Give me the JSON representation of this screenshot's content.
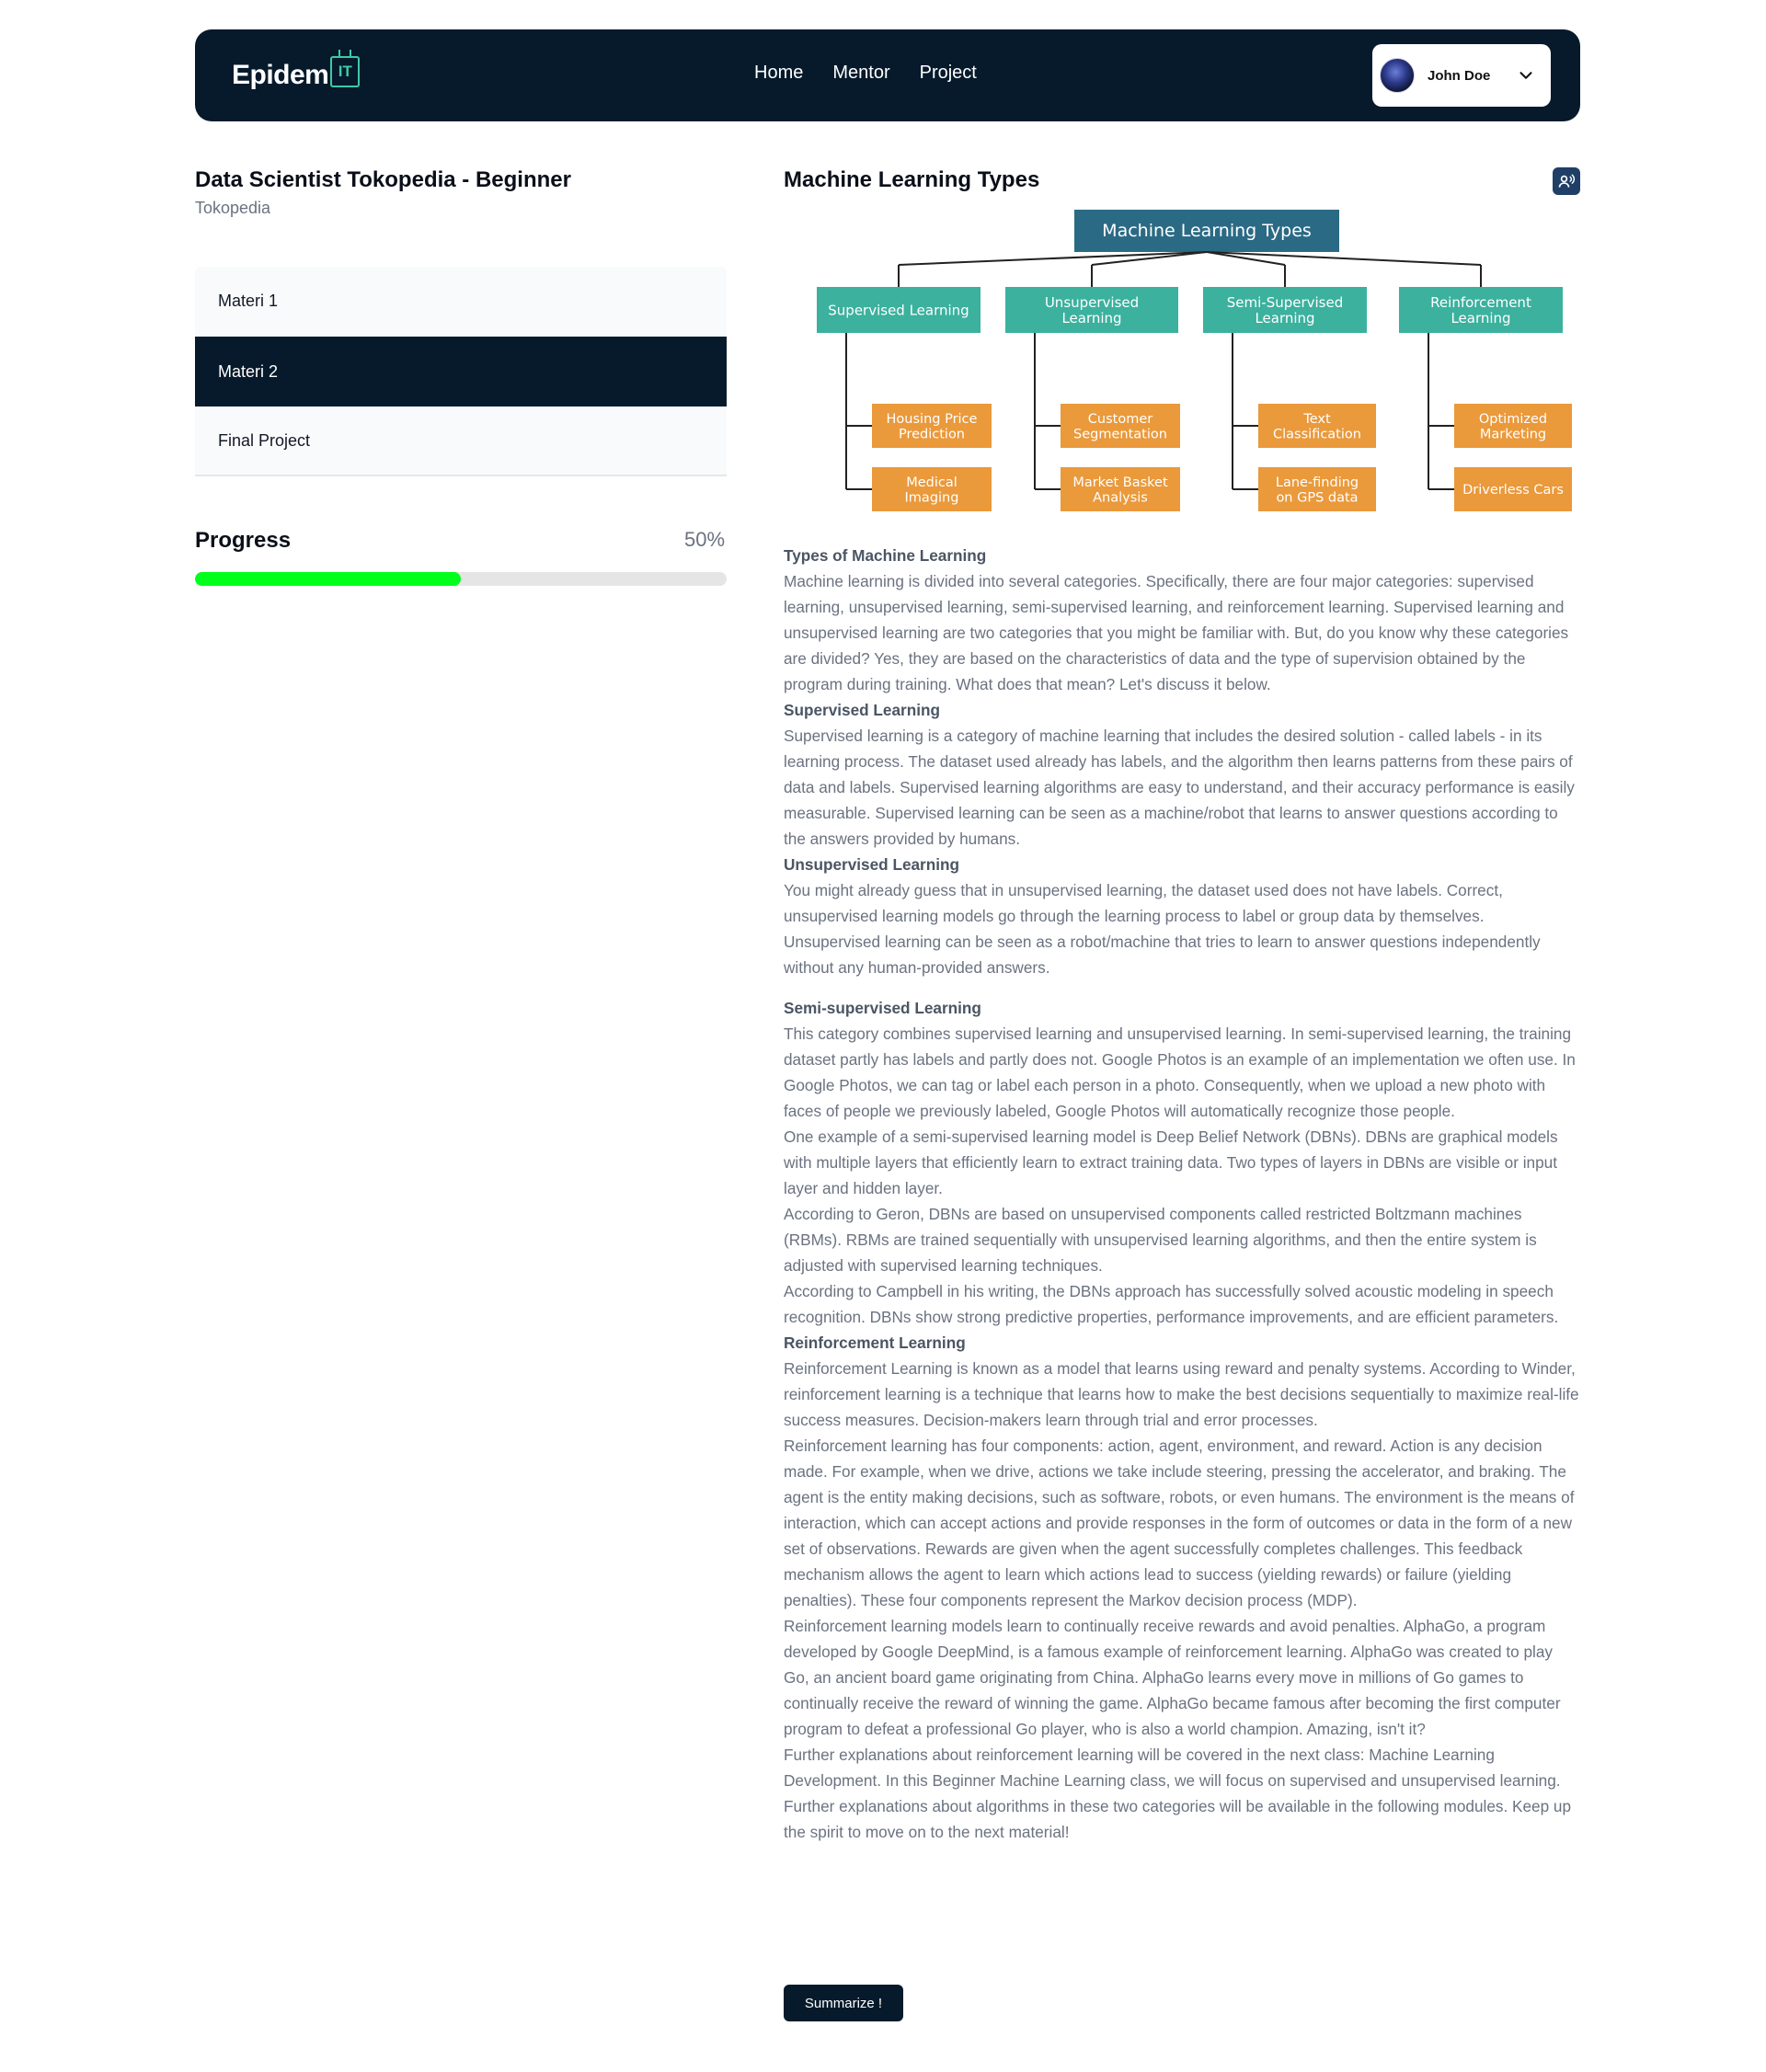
{
  "header": {
    "logo_text": "Epidem",
    "logo_badge": "IT",
    "nav": [
      "Home",
      "Mentor",
      "Project"
    ],
    "user": {
      "name": "John Doe",
      "avatar_icon": "user-avatar",
      "menu_icon": "chevron-down-icon"
    }
  },
  "course": {
    "title": "Data Scientist Tokopedia - Beginner",
    "provider": "Tokopedia",
    "items": [
      {
        "label": "Materi 1",
        "active": false
      },
      {
        "label": "Materi 2",
        "active": true
      },
      {
        "label": "Final Project",
        "active": false
      }
    ],
    "progress": {
      "label": "Progress",
      "value_text": "50%",
      "percent": 50,
      "color": "#00ff1a"
    }
  },
  "content": {
    "title": "Machine Learning Types",
    "tts_icon": "speaker-icon",
    "diagram": {
      "root": "Machine Learning Types",
      "colors": {
        "root": "#2b6a84",
        "category": "#3bb19e",
        "example": "#ea993b"
      },
      "categories": [
        {
          "label": [
            "Supervised Learning"
          ],
          "examples": [
            [
              "Housing Price",
              "Prediction"
            ],
            [
              "Medical",
              "Imaging"
            ]
          ]
        },
        {
          "label": [
            "Unsupervised",
            "Learning"
          ],
          "examples": [
            [
              "Customer",
              "Segmentation"
            ],
            [
              "Market Basket",
              "Analysis"
            ]
          ]
        },
        {
          "label": [
            "Semi-Supervised",
            "Learning"
          ],
          "examples": [
            [
              "Text",
              "Classification"
            ],
            [
              "Lane-finding",
              "on GPS data"
            ]
          ]
        },
        {
          "label": [
            "Reinforcement",
            "Learning"
          ],
          "examples": [
            [
              "Optimized",
              "Marketing"
            ],
            [
              "Driverless Cars"
            ]
          ]
        }
      ]
    },
    "article": {
      "h1": "Types of Machine Learning",
      "p1": "Machine learning is divided into several categories. Specifically, there are four major categories: supervised learning, unsupervised learning, semi-supervised learning, and reinforcement learning. Supervised learning and unsupervised learning are two categories that you might be familiar with. But, do you know why these categories are divided? Yes, they are based on the characteristics of data and the type of supervision obtained by the program during training. What does that mean? Let's discuss it below.",
      "h2": "Supervised Learning",
      "p2": "Supervised learning is a category of machine learning that includes the desired solution - called labels - in its learning process. The dataset used already has labels, and the algorithm then learns patterns from these pairs of data and labels. Supervised learning algorithms are easy to understand, and their accuracy performance is easily measurable. Supervised learning can be seen as a machine/robot that learns to answer questions according to the answers provided by humans.",
      "h3": "Unsupervised Learning",
      "p3": "You might already guess that in unsupervised learning, the dataset used does not have labels. Correct, unsupervised learning models go through the learning process to label or group data by themselves. Unsupervised learning can be seen as a robot/machine that tries to learn to answer questions independently without any human-provided answers.",
      "h4": "Semi-supervised Learning",
      "p4": "This category combines supervised learning and unsupervised learning. In semi-supervised learning, the training dataset partly has labels and partly does not. Google Photos is an example of an implementation we often use. In Google Photos, we can tag or label each person in a photo. Consequently, when we upload a new photo with faces of people we previously labeled, Google Photos will automatically recognize those people.",
      "p5": "One example of a semi-supervised learning model is Deep Belief Network (DBNs). DBNs are graphical models with multiple layers that efficiently learn to extract training data. Two types of layers in DBNs are visible or input layer and hidden layer.",
      "p6": "According to Geron, DBNs are based on unsupervised components called restricted Boltzmann machines (RBMs). RBMs are trained sequentially with unsupervised learning algorithms, and then the entire system is adjusted with supervised learning techniques.",
      "p7": "According to Campbell in his writing, the DBNs approach has successfully solved acoustic modeling in speech recognition. DBNs show strong predictive properties, performance improvements, and are efficient parameters.",
      "h5": "Reinforcement Learning",
      "p8": "Reinforcement Learning is known as a model that learns using reward and penalty systems. According to Winder, reinforcement learning is a technique that learns how to make the best decisions sequentially to maximize real-life success measures. Decision-makers learn through trial and error processes.",
      "p9": "Reinforcement learning has four components: action, agent, environment, and reward. Action is any decision made. For example, when we drive, actions we take include steering, pressing the accelerator, and braking. The agent is the entity making decisions, such as software, robots, or even humans. The environment is the means of interaction, which can accept actions and provide responses in the form of outcomes or data in the form of a new set of observations. Rewards are given when the agent successfully completes challenges. This feedback mechanism allows the agent to learn which actions lead to success (yielding rewards) or failure (yielding penalties). These four components represent the Markov decision process (MDP).",
      "p10": "Reinforcement learning models learn to continually receive rewards and avoid penalties. AlphaGo, a program developed by Google DeepMind, is a famous example of reinforcement learning. AlphaGo was created to play Go, an ancient board game originating from China. AlphaGo learns every move in millions of Go games to continually receive the reward of winning the game. AlphaGo became famous after becoming the first computer program to defeat a professional Go player, who is also a world champion. Amazing, isn't it?",
      "p11": "Further explanations about reinforcement learning will be covered in the next class: Machine Learning Development. In this Beginner Machine Learning class, we will focus on supervised and unsupervised learning. Further explanations about algorithms in these two categories will be available in the following modules. Keep up the spirit to move on to the next material!"
    },
    "summarize_label": "Summarize !"
  }
}
